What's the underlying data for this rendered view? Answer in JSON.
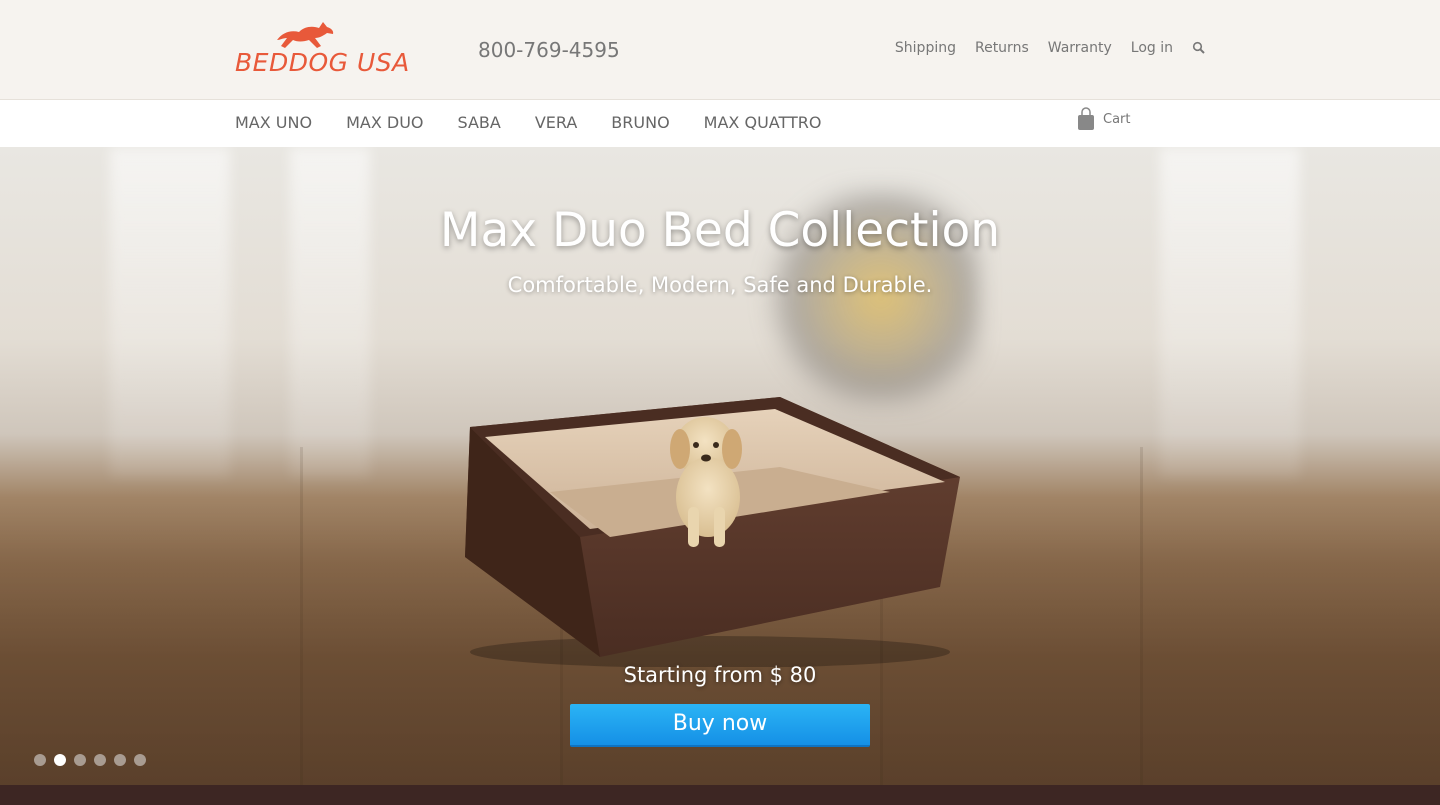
{
  "brand": {
    "logo_text": "BEDDOG USA",
    "accent_color": "#e8593a"
  },
  "header": {
    "phone": "800-769-4595",
    "links": [
      "Shipping",
      "Returns",
      "Warranty",
      "Log in"
    ],
    "search_icon": "search-icon"
  },
  "nav": {
    "items": [
      "MAX UNO",
      "MAX DUO",
      "SABA",
      "VERA",
      "BRUNO",
      "MAX QUATTRO"
    ],
    "cart_label": "Cart",
    "cart_icon": "shopping-bag-icon"
  },
  "hero": {
    "title": "Max Duo Bed Collection",
    "subtitle": "Comfortable, Modern, Safe and Durable.",
    "price_text": "Starting from $ 80",
    "button_label": "Buy now",
    "button_color": "#1a9cec",
    "slides_total": 6,
    "active_slide": 2
  },
  "footer": {
    "color": "#3d2623"
  }
}
